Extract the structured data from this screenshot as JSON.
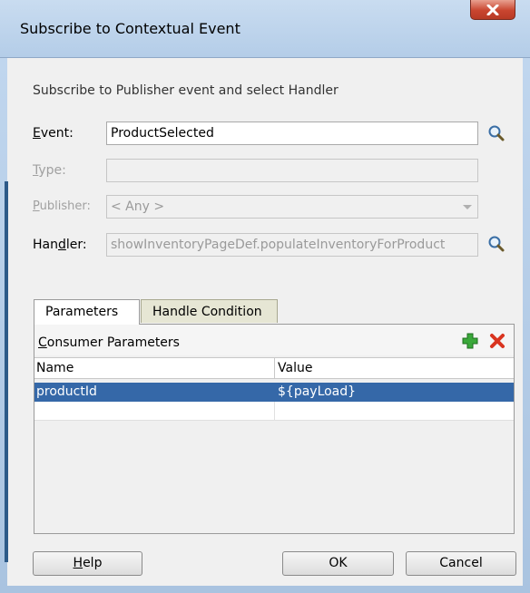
{
  "window": {
    "title": "Subscribe to Contextual Event"
  },
  "subtitle": "Subscribe to Publisher event and select Handler",
  "form": {
    "event_label_u": "E",
    "event_label_rest": "vent:",
    "event_value": "ProductSelected",
    "type_label_u": "T",
    "type_label_rest": "ype:",
    "type_value": "",
    "publisher_label_u": "P",
    "publisher_label_rest": "ublisher:",
    "publisher_value": "< Any >",
    "handler_label_a": "Han",
    "handler_label_u": "d",
    "handler_label_b": "ler:",
    "handler_value": "showInventoryPageDef.populateInventoryForProduct"
  },
  "tabs": [
    {
      "label": "Parameters",
      "active": true
    },
    {
      "label": "Handle Condition",
      "active": false
    }
  ],
  "consumer": {
    "title_u": "C",
    "title_rest": "onsumer Parameters",
    "columns": [
      "Name",
      "Value"
    ],
    "rows": [
      {
        "name": "productId",
        "value": "${payLoad}"
      }
    ]
  },
  "buttons": {
    "help_u": "H",
    "help_rest": "elp",
    "ok": "OK",
    "cancel": "Cancel"
  },
  "colors": {
    "selection": "#3568a8",
    "close": "#c9452f",
    "add": "#2f9a2f",
    "delete": "#d9341f"
  },
  "icons": [
    "close-icon",
    "search-icon",
    "add-icon",
    "delete-icon",
    "chevron-down-icon"
  ]
}
